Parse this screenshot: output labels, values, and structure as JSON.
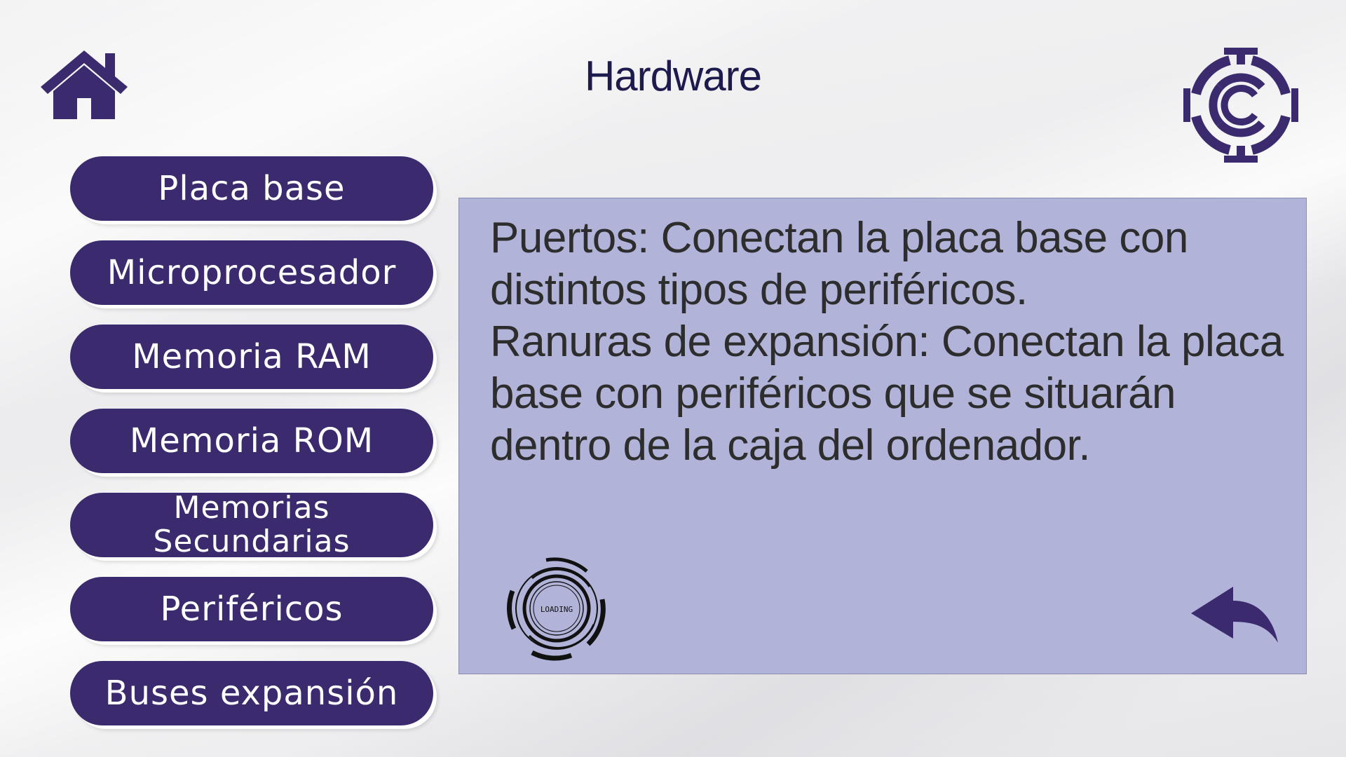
{
  "header": {
    "title": "Hardware",
    "home_icon": "home-icon",
    "logo_icon": "circular-c-logo-icon"
  },
  "menu": {
    "items": [
      {
        "label": "Placa base"
      },
      {
        "label": "Microprocesador"
      },
      {
        "label": "Memoria RAM"
      },
      {
        "label": "Memoria ROM"
      },
      {
        "label": "Memorias Secundarias"
      },
      {
        "label": "Periféricos"
      },
      {
        "label": "Buses expansión"
      }
    ]
  },
  "panel": {
    "paragraphs": [
      "Puertos: Conectan la placa base con distintos tipos de periféricos.",
      "Ranuras de expansión: Conectan la placa base con periféricos que se situarán dentro de la caja del ordenador."
    ],
    "loading_label": "LOADING",
    "back_icon": "back-arrow-icon"
  },
  "colors": {
    "primary": "#3b2a6e",
    "title": "#1d1a4d",
    "panel_bg": "#b1b3d9",
    "panel_text": "#2d2d2d"
  }
}
